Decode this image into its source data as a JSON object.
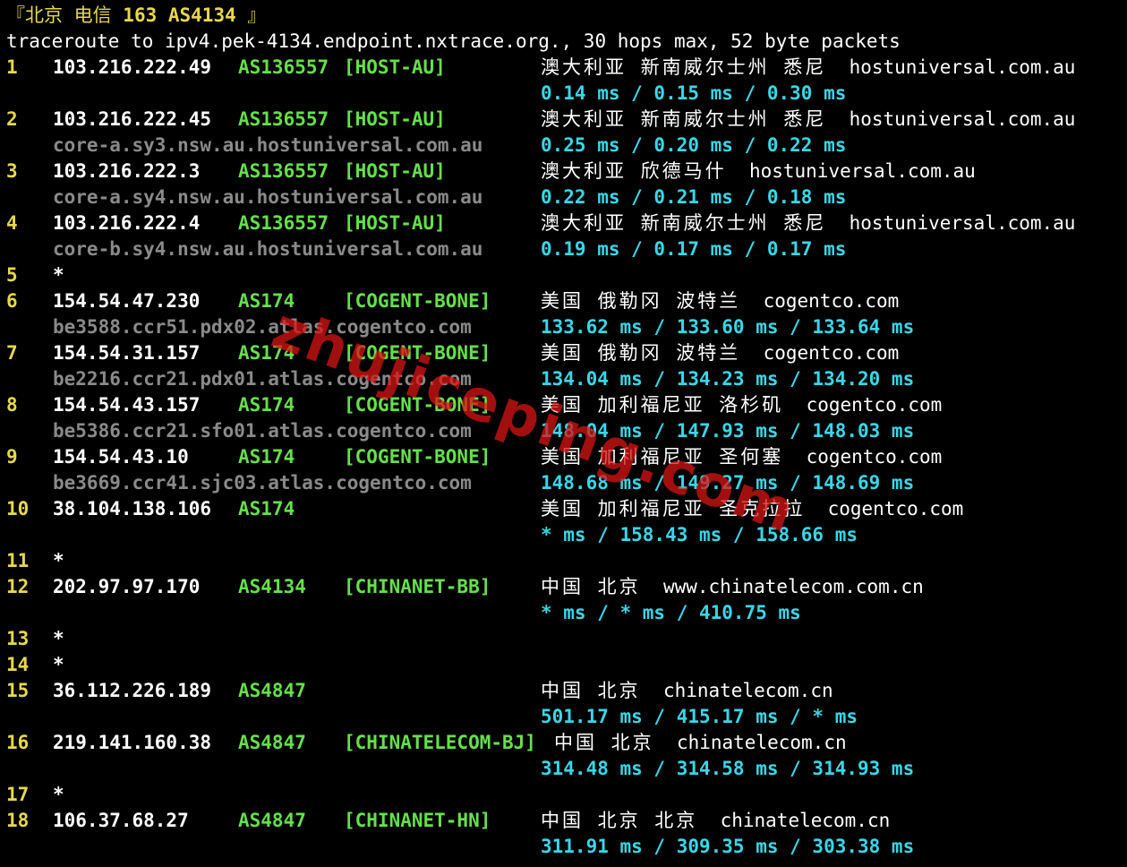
{
  "title": {
    "open": "『北京 电信 ",
    "bold": "163 AS4134",
    "close": " 』"
  },
  "summary": "traceroute to ipv4.pek-4134.endpoint.nxtrace.org., 30 hops max, 52 byte packets",
  "watermark": "zhujiceping.com",
  "hops": [
    {
      "num": "1",
      "ip": "103.216.222.49",
      "asn": "AS136557",
      "tag": "[HOST-AU]",
      "loc": "澳大利亚 新南威尔士州 悉尼",
      "domain": "hostuniversal.com.au",
      "ptr": "",
      "rtt": "0.14 ms / 0.15 ms / 0.30 ms"
    },
    {
      "num": "2",
      "ip": "103.216.222.45",
      "asn": "AS136557",
      "tag": "[HOST-AU]",
      "loc": "澳大利亚 新南威尔士州 悉尼",
      "domain": "hostuniversal.com.au",
      "ptr": "core-a.sy3.nsw.au.hostuniversal.com.au",
      "rtt": "0.25 ms / 0.20 ms / 0.22 ms"
    },
    {
      "num": "3",
      "ip": "103.216.222.3",
      "asn": "AS136557",
      "tag": "[HOST-AU]",
      "loc": "澳大利亚 欣德马什",
      "domain": "hostuniversal.com.au",
      "ptr": "core-a.sy4.nsw.au.hostuniversal.com.au",
      "rtt": "0.22 ms / 0.21 ms / 0.18 ms"
    },
    {
      "num": "4",
      "ip": "103.216.222.4",
      "asn": "AS136557",
      "tag": "[HOST-AU]",
      "loc": "澳大利亚 新南威尔士州 悉尼",
      "domain": "hostuniversal.com.au",
      "ptr": "core-b.sy4.nsw.au.hostuniversal.com.au",
      "rtt": "0.19 ms / 0.17 ms / 0.17 ms"
    },
    {
      "num": "5",
      "star": "*"
    },
    {
      "num": "6",
      "ip": "154.54.47.230",
      "asn": "AS174",
      "tag": "[COGENT-BONE]",
      "loc": "美国 俄勒冈 波特兰",
      "domain": "cogentco.com",
      "ptr": "be3588.ccr51.pdx02.atlas.cogentco.com",
      "rtt": "133.62 ms / 133.60 ms / 133.64 ms"
    },
    {
      "num": "7",
      "ip": "154.54.31.157",
      "asn": "AS174",
      "tag": "[COGENT-BONE]",
      "loc": "美国 俄勒冈 波特兰",
      "domain": "cogentco.com",
      "ptr": "be2216.ccr21.pdx01.atlas.cogentco.com",
      "rtt": "134.04 ms / 134.23 ms / 134.20 ms"
    },
    {
      "num": "8",
      "ip": "154.54.43.157",
      "asn": "AS174",
      "tag": "[COGENT-BONE]",
      "loc": "美国 加利福尼亚 洛杉矶",
      "domain": "cogentco.com",
      "ptr": "be5386.ccr21.sfo01.atlas.cogentco.com",
      "rtt": "148.04 ms / 147.93 ms / 148.03 ms"
    },
    {
      "num": "9",
      "ip": "154.54.43.10",
      "asn": "AS174",
      "tag": "[COGENT-BONE]",
      "loc": "美国 加利福尼亚 圣何塞",
      "domain": "cogentco.com",
      "ptr": "be3669.ccr41.sjc03.atlas.cogentco.com",
      "rtt": "148.68 ms / 149.27 ms / 148.69 ms"
    },
    {
      "num": "10",
      "ip": "38.104.138.106",
      "asn": "AS174",
      "tag": "",
      "loc": "美国 加利福尼亚 圣克拉拉",
      "domain": "cogentco.com",
      "ptr": "",
      "rtt": "* ms / 158.43 ms / 158.66 ms"
    },
    {
      "num": "11",
      "star": "*"
    },
    {
      "num": "12",
      "ip": "202.97.97.170",
      "asn": "AS4134",
      "tag": "[CHINANET-BB]",
      "loc": "中国 北京",
      "domain": "www.chinatelecom.com.cn",
      "ptr": "",
      "rtt": "* ms / * ms / 410.75 ms"
    },
    {
      "num": "13",
      "star": "*"
    },
    {
      "num": "14",
      "star": "*"
    },
    {
      "num": "15",
      "ip": "36.112.226.189",
      "asn": "AS4847",
      "tag": "",
      "loc": "中国 北京",
      "domain": "chinatelecom.cn",
      "ptr": "",
      "rtt": "501.17 ms / 415.17 ms / * ms"
    },
    {
      "num": "16",
      "ip": "219.141.160.38",
      "asn": "AS4847",
      "tag": "[CHINATELECOM-BJ]",
      "loc": "中国 北京",
      "domain": "chinatelecom.cn",
      "ptr": "",
      "rtt": "314.48 ms / 314.58 ms / 314.93 ms"
    },
    {
      "num": "17",
      "star": "*"
    },
    {
      "num": "18",
      "ip": "106.37.68.27",
      "asn": "AS4847",
      "tag": "[CHINANET-HN]",
      "loc": "中国 北京 北京",
      "domain": "chinatelecom.cn",
      "ptr": "",
      "rtt": "311.91 ms / 309.35 ms / 303.38 ms"
    }
  ]
}
